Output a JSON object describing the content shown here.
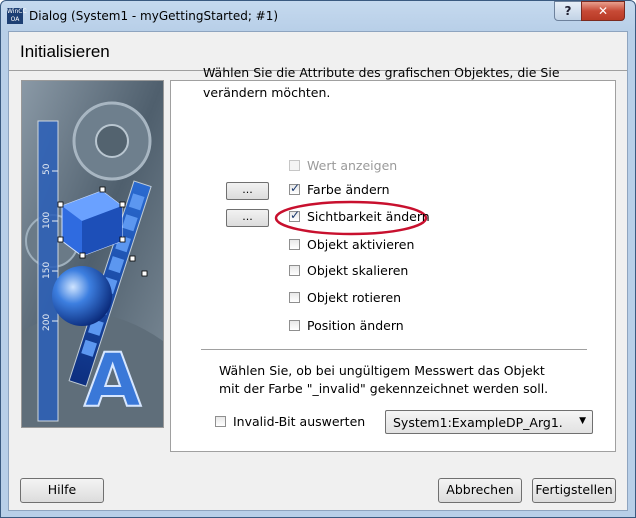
{
  "window": {
    "title": "Dialog (System1 - myGettingStarted; #1)",
    "icon_text": "WinCC OA",
    "help_button": "?",
    "close_button": "✕"
  },
  "header": {
    "title": "Initialisieren"
  },
  "picture": {
    "ticks": [
      "50",
      "100",
      "150",
      "200"
    ],
    "letter": "A"
  },
  "panel": {
    "intro_line1": "Wählen Sie die Attribute des grafischen Objektes, die Sie",
    "intro_line2": "verändern möchten.",
    "options": [
      {
        "label": "Wert anzeigen",
        "checked": false,
        "enabled": false
      },
      {
        "label": "Farbe ändern",
        "checked": true,
        "enabled": true,
        "button": "..."
      },
      {
        "label": "Sichtbarkeit ändern",
        "checked": true,
        "enabled": true,
        "button": "...",
        "highlighted": true
      },
      {
        "label": "Objekt aktivieren",
        "checked": false,
        "enabled": true
      },
      {
        "label": "Objekt skalieren",
        "checked": false,
        "enabled": true
      },
      {
        "label": "Objekt rotieren",
        "checked": false,
        "enabled": true
      },
      {
        "label": "Position ändern",
        "checked": false,
        "enabled": true
      }
    ],
    "invalid_line1": "Wählen Sie, ob bei ungültigem Messwert das Objekt",
    "invalid_line2": "mit der Farbe \"_invalid\" gekennzeichnet werden soll.",
    "invalid_bit_label": "Invalid-Bit auswerten",
    "invalid_bit_checked": false,
    "dp_select": "System1:ExampleDP_Arg1."
  },
  "footer": {
    "help": "Hilfe",
    "cancel": "Abbrechen",
    "finish": "Fertigstellen"
  },
  "colors": {
    "highlight_ellipse": "#c8102e",
    "titlebar": "#b8cfe8"
  }
}
